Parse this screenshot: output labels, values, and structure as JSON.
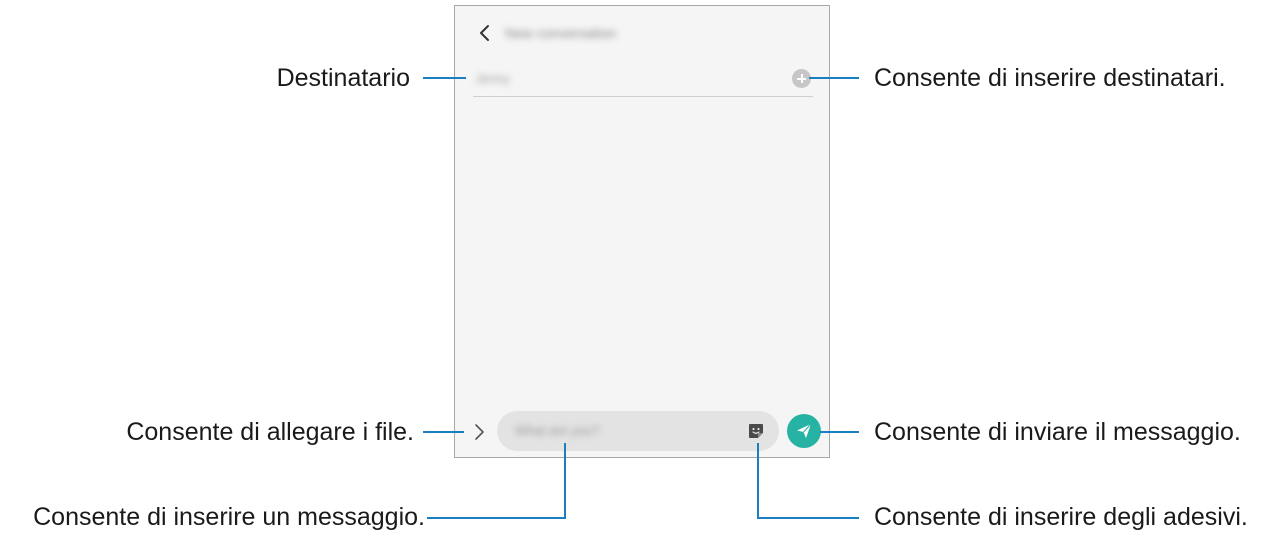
{
  "screen": {
    "title": "New conversation",
    "recipient_placeholder": "Jenny",
    "message_placeholder": "What are you?"
  },
  "callouts": {
    "recipient": "Destinatario",
    "add_recipients": "Consente di inserire destinatari.",
    "attach_files": "Consente di allegare i file.",
    "send_message": "Consente di inviare il messaggio.",
    "enter_message": "Consente di inserire un messaggio.",
    "enter_stickers": "Consente di inserire degli adesivi."
  },
  "icons": {
    "back": "chevron-left-icon",
    "add": "plus-circle-icon",
    "attach": "chevron-right-icon",
    "sticker": "sticker-icon",
    "send": "send-icon"
  },
  "colors": {
    "accent": "#26b3a3",
    "callout_line": "#1a7fbf",
    "screen_background": "#f5f5f5"
  }
}
